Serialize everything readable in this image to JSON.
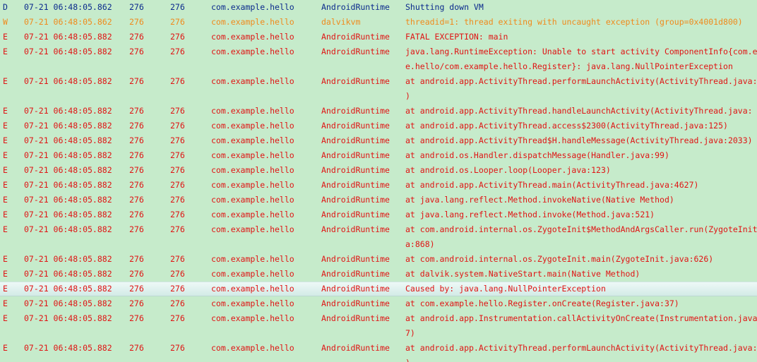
{
  "logcat": {
    "level_colors": {
      "D": "#0b2a8c",
      "W": "#f08a1c",
      "E": "#e01414"
    },
    "background_color": "#c6ebcb",
    "selected_row_color": "#e1f3f0",
    "rows": [
      {
        "level": "D",
        "time": "07-21 06:48:05.862",
        "pid": "276",
        "tid": "276",
        "app": "com.example.hello",
        "tag": "AndroidRuntime",
        "text": "Shutting down VM",
        "cont": ""
      },
      {
        "level": "W",
        "time": "07-21 06:48:05.862",
        "pid": "276",
        "tid": "276",
        "app": "com.example.hello",
        "tag": "dalvikvm",
        "text": "threadid=1: thread exiting with uncaught exception (group=0x4001d800)",
        "cont": ""
      },
      {
        "level": "E",
        "time": "07-21 06:48:05.882",
        "pid": "276",
        "tid": "276",
        "app": "com.example.hello",
        "tag": "AndroidRuntime",
        "text": "FATAL EXCEPTION: main",
        "cont": ""
      },
      {
        "level": "E",
        "time": "07-21 06:48:05.882",
        "pid": "276",
        "tid": "276",
        "app": "com.example.hello",
        "tag": "AndroidRuntime",
        "text": "java.lang.RuntimeException: Unable to start activity ComponentInfo{com.ex",
        "cont": "e.hello/com.example.hello.Register}: java.lang.NullPointerException"
      },
      {
        "level": "E",
        "time": "07-21 06:48:05.882",
        "pid": "276",
        "tid": "276",
        "app": "com.example.hello",
        "tag": "AndroidRuntime",
        "text": "at android.app.ActivityThread.performLaunchActivity(ActivityThread.java:",
        "cont": ")"
      },
      {
        "level": "E",
        "time": "07-21 06:48:05.882",
        "pid": "276",
        "tid": "276",
        "app": "com.example.hello",
        "tag": "AndroidRuntime",
        "text": "at android.app.ActivityThread.handleLaunchActivity(ActivityThread.java:",
        "cont": ""
      },
      {
        "level": "E",
        "time": "07-21 06:48:05.882",
        "pid": "276",
        "tid": "276",
        "app": "com.example.hello",
        "tag": "AndroidRuntime",
        "text": "at android.app.ActivityThread.access$2300(ActivityThread.java:125)",
        "cont": ""
      },
      {
        "level": "E",
        "time": "07-21 06:48:05.882",
        "pid": "276",
        "tid": "276",
        "app": "com.example.hello",
        "tag": "AndroidRuntime",
        "text": "at android.app.ActivityThread$H.handleMessage(ActivityThread.java:2033)",
        "cont": ""
      },
      {
        "level": "E",
        "time": "07-21 06:48:05.882",
        "pid": "276",
        "tid": "276",
        "app": "com.example.hello",
        "tag": "AndroidRuntime",
        "text": "at android.os.Handler.dispatchMessage(Handler.java:99)",
        "cont": ""
      },
      {
        "level": "E",
        "time": "07-21 06:48:05.882",
        "pid": "276",
        "tid": "276",
        "app": "com.example.hello",
        "tag": "AndroidRuntime",
        "text": "at android.os.Looper.loop(Looper.java:123)",
        "cont": ""
      },
      {
        "level": "E",
        "time": "07-21 06:48:05.882",
        "pid": "276",
        "tid": "276",
        "app": "com.example.hello",
        "tag": "AndroidRuntime",
        "text": "at android.app.ActivityThread.main(ActivityThread.java:4627)",
        "cont": ""
      },
      {
        "level": "E",
        "time": "07-21 06:48:05.882",
        "pid": "276",
        "tid": "276",
        "app": "com.example.hello",
        "tag": "AndroidRuntime",
        "text": "at java.lang.reflect.Method.invokeNative(Native Method)",
        "cont": ""
      },
      {
        "level": "E",
        "time": "07-21 06:48:05.882",
        "pid": "276",
        "tid": "276",
        "app": "com.example.hello",
        "tag": "AndroidRuntime",
        "text": "at java.lang.reflect.Method.invoke(Method.java:521)",
        "cont": ""
      },
      {
        "level": "E",
        "time": "07-21 06:48:05.882",
        "pid": "276",
        "tid": "276",
        "app": "com.example.hello",
        "tag": "AndroidRuntime",
        "text": "at com.android.internal.os.ZygoteInit$MethodAndArgsCaller.run(ZygoteInit",
        "cont": "a:868)"
      },
      {
        "level": "E",
        "time": "07-21 06:48:05.882",
        "pid": "276",
        "tid": "276",
        "app": "com.example.hello",
        "tag": "AndroidRuntime",
        "text": "at com.android.internal.os.ZygoteInit.main(ZygoteInit.java:626)",
        "cont": ""
      },
      {
        "level": "E",
        "time": "07-21 06:48:05.882",
        "pid": "276",
        "tid": "276",
        "app": "com.example.hello",
        "tag": "AndroidRuntime",
        "text": "at dalvik.system.NativeStart.main(Native Method)",
        "cont": ""
      },
      {
        "level": "E",
        "time": "07-21 06:48:05.882",
        "pid": "276",
        "tid": "276",
        "app": "com.example.hello",
        "tag": "AndroidRuntime",
        "text": "Caused by: java.lang.NullPointerException",
        "cont": "",
        "selected": true
      },
      {
        "level": "E",
        "time": "07-21 06:48:05.882",
        "pid": "276",
        "tid": "276",
        "app": "com.example.hello",
        "tag": "AndroidRuntime",
        "text": "at com.example.hello.Register.onCreate(Register.java:37)",
        "cont": ""
      },
      {
        "level": "E",
        "time": "07-21 06:48:05.882",
        "pid": "276",
        "tid": "276",
        "app": "com.example.hello",
        "tag": "AndroidRuntime",
        "text": "at android.app.Instrumentation.callActivityOnCreate(Instrumentation.java",
        "cont": "7)"
      },
      {
        "level": "E",
        "time": "07-21 06:48:05.882",
        "pid": "276",
        "tid": "276",
        "app": "com.example.hello",
        "tag": "AndroidRuntime",
        "text": "at android.app.ActivityThread.performLaunchActivity(ActivityThread.java:",
        "cont": ")"
      }
    ]
  }
}
